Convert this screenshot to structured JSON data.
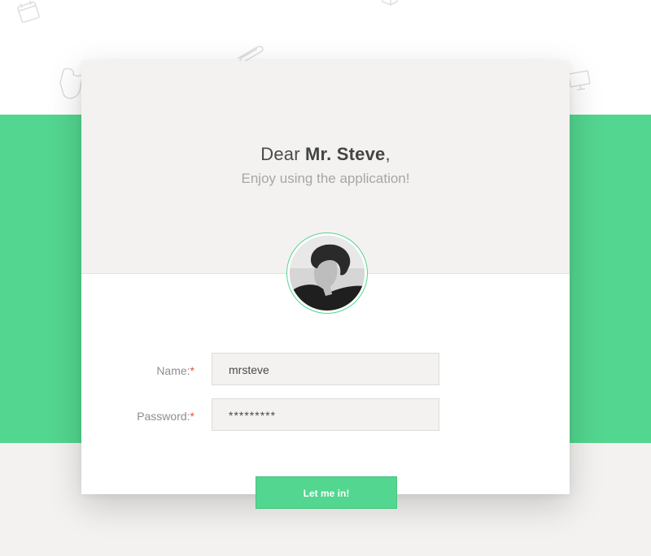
{
  "greeting": {
    "prefix": "Dear ",
    "name": "Mr. Steve",
    "suffix": ","
  },
  "subtitle": "Enjoy using the application!",
  "form": {
    "name_label": "Name:",
    "password_label": "Password:",
    "required_marker": "*",
    "name_value": "mrsteve",
    "password_value": "*********"
  },
  "submit_label": "Let me in!",
  "colors": {
    "accent": "#53d68f",
    "required": "#e2533e",
    "card_top": "#f3f2f1"
  },
  "decorations": [
    "calendar-icon",
    "paperclip-icon",
    "puzzle-icon",
    "monitor-icon",
    "cube-icon"
  ]
}
